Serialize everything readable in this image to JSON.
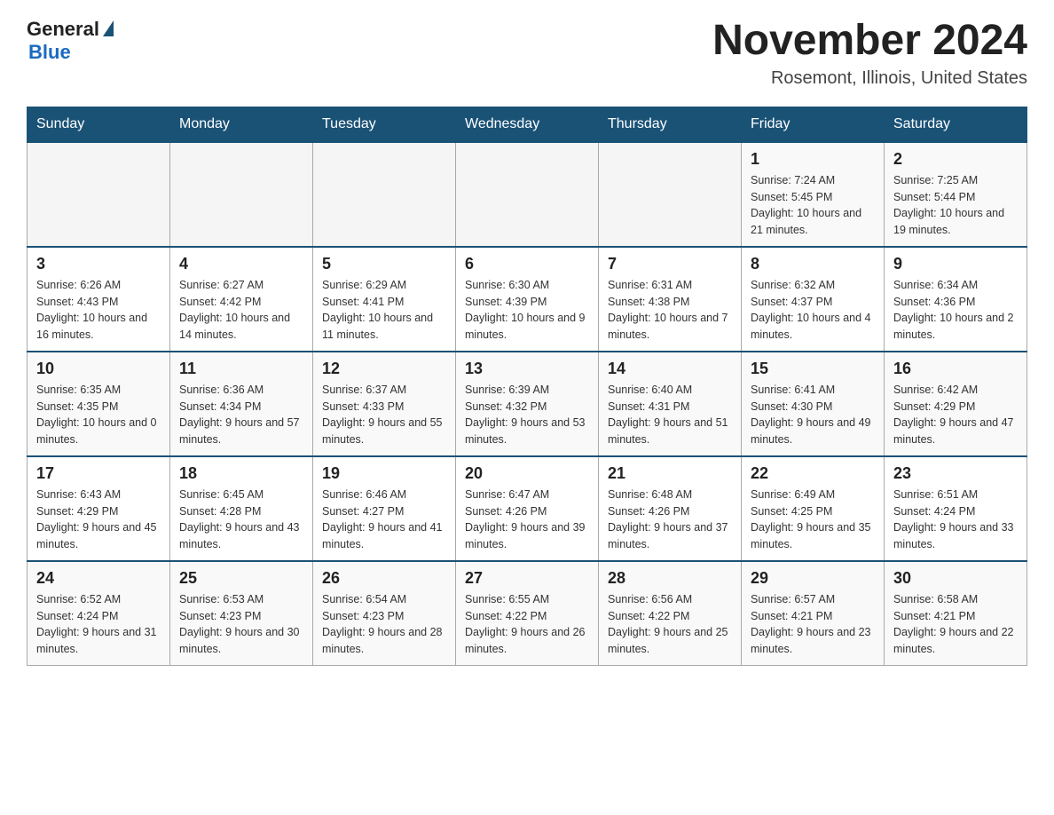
{
  "header": {
    "logo_general": "General",
    "logo_blue": "Blue",
    "main_title": "November 2024",
    "subtitle": "Rosemont, Illinois, United States"
  },
  "calendar": {
    "days_of_week": [
      "Sunday",
      "Monday",
      "Tuesday",
      "Wednesday",
      "Thursday",
      "Friday",
      "Saturday"
    ],
    "weeks": [
      [
        {
          "day": "",
          "info": ""
        },
        {
          "day": "",
          "info": ""
        },
        {
          "day": "",
          "info": ""
        },
        {
          "day": "",
          "info": ""
        },
        {
          "day": "",
          "info": ""
        },
        {
          "day": "1",
          "info": "Sunrise: 7:24 AM\nSunset: 5:45 PM\nDaylight: 10 hours and 21 minutes."
        },
        {
          "day": "2",
          "info": "Sunrise: 7:25 AM\nSunset: 5:44 PM\nDaylight: 10 hours and 19 minutes."
        }
      ],
      [
        {
          "day": "3",
          "info": "Sunrise: 6:26 AM\nSunset: 4:43 PM\nDaylight: 10 hours and 16 minutes."
        },
        {
          "day": "4",
          "info": "Sunrise: 6:27 AM\nSunset: 4:42 PM\nDaylight: 10 hours and 14 minutes."
        },
        {
          "day": "5",
          "info": "Sunrise: 6:29 AM\nSunset: 4:41 PM\nDaylight: 10 hours and 11 minutes."
        },
        {
          "day": "6",
          "info": "Sunrise: 6:30 AM\nSunset: 4:39 PM\nDaylight: 10 hours and 9 minutes."
        },
        {
          "day": "7",
          "info": "Sunrise: 6:31 AM\nSunset: 4:38 PM\nDaylight: 10 hours and 7 minutes."
        },
        {
          "day": "8",
          "info": "Sunrise: 6:32 AM\nSunset: 4:37 PM\nDaylight: 10 hours and 4 minutes."
        },
        {
          "day": "9",
          "info": "Sunrise: 6:34 AM\nSunset: 4:36 PM\nDaylight: 10 hours and 2 minutes."
        }
      ],
      [
        {
          "day": "10",
          "info": "Sunrise: 6:35 AM\nSunset: 4:35 PM\nDaylight: 10 hours and 0 minutes."
        },
        {
          "day": "11",
          "info": "Sunrise: 6:36 AM\nSunset: 4:34 PM\nDaylight: 9 hours and 57 minutes."
        },
        {
          "day": "12",
          "info": "Sunrise: 6:37 AM\nSunset: 4:33 PM\nDaylight: 9 hours and 55 minutes."
        },
        {
          "day": "13",
          "info": "Sunrise: 6:39 AM\nSunset: 4:32 PM\nDaylight: 9 hours and 53 minutes."
        },
        {
          "day": "14",
          "info": "Sunrise: 6:40 AM\nSunset: 4:31 PM\nDaylight: 9 hours and 51 minutes."
        },
        {
          "day": "15",
          "info": "Sunrise: 6:41 AM\nSunset: 4:30 PM\nDaylight: 9 hours and 49 minutes."
        },
        {
          "day": "16",
          "info": "Sunrise: 6:42 AM\nSunset: 4:29 PM\nDaylight: 9 hours and 47 minutes."
        }
      ],
      [
        {
          "day": "17",
          "info": "Sunrise: 6:43 AM\nSunset: 4:29 PM\nDaylight: 9 hours and 45 minutes."
        },
        {
          "day": "18",
          "info": "Sunrise: 6:45 AM\nSunset: 4:28 PM\nDaylight: 9 hours and 43 minutes."
        },
        {
          "day": "19",
          "info": "Sunrise: 6:46 AM\nSunset: 4:27 PM\nDaylight: 9 hours and 41 minutes."
        },
        {
          "day": "20",
          "info": "Sunrise: 6:47 AM\nSunset: 4:26 PM\nDaylight: 9 hours and 39 minutes."
        },
        {
          "day": "21",
          "info": "Sunrise: 6:48 AM\nSunset: 4:26 PM\nDaylight: 9 hours and 37 minutes."
        },
        {
          "day": "22",
          "info": "Sunrise: 6:49 AM\nSunset: 4:25 PM\nDaylight: 9 hours and 35 minutes."
        },
        {
          "day": "23",
          "info": "Sunrise: 6:51 AM\nSunset: 4:24 PM\nDaylight: 9 hours and 33 minutes."
        }
      ],
      [
        {
          "day": "24",
          "info": "Sunrise: 6:52 AM\nSunset: 4:24 PM\nDaylight: 9 hours and 31 minutes."
        },
        {
          "day": "25",
          "info": "Sunrise: 6:53 AM\nSunset: 4:23 PM\nDaylight: 9 hours and 30 minutes."
        },
        {
          "day": "26",
          "info": "Sunrise: 6:54 AM\nSunset: 4:23 PM\nDaylight: 9 hours and 28 minutes."
        },
        {
          "day": "27",
          "info": "Sunrise: 6:55 AM\nSunset: 4:22 PM\nDaylight: 9 hours and 26 minutes."
        },
        {
          "day": "28",
          "info": "Sunrise: 6:56 AM\nSunset: 4:22 PM\nDaylight: 9 hours and 25 minutes."
        },
        {
          "day": "29",
          "info": "Sunrise: 6:57 AM\nSunset: 4:21 PM\nDaylight: 9 hours and 23 minutes."
        },
        {
          "day": "30",
          "info": "Sunrise: 6:58 AM\nSunset: 4:21 PM\nDaylight: 9 hours and 22 minutes."
        }
      ]
    ]
  }
}
